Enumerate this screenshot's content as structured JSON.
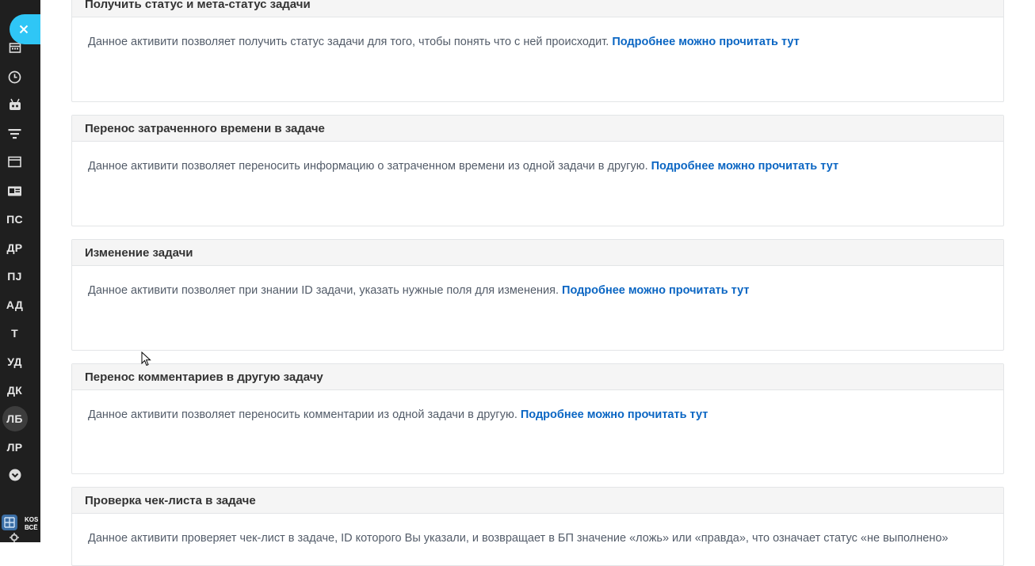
{
  "sidebar": {
    "close_icon": "close-icon",
    "icons": [
      "calendar-icon",
      "clock-icon",
      "robot-icon",
      "filter-icon",
      "window-icon",
      "contact-card-icon"
    ],
    "avatars": [
      {
        "label": "ПС"
      },
      {
        "label": "ДР"
      },
      {
        "label": "ПJ"
      },
      {
        "label": "АД"
      },
      {
        "label": "Т"
      },
      {
        "label": "УД"
      },
      {
        "label": "ДК"
      },
      {
        "label": "ЛБ",
        "active": true
      },
      {
        "label": "ЛР"
      }
    ],
    "more_icon": "chevron-down-circle-icon",
    "brand_text_line1": "KOS",
    "brand_text_line2": "ВСЁ"
  },
  "cards": [
    {
      "title": "Получить статус и мета-статус задачи",
      "description": "Данное активити позволяет получить статус задачи для того, чтобы понять что с ней происходит.",
      "link": "Подробнее можно прочитать тут"
    },
    {
      "title": "Перенос затраченного времени в задаче",
      "description": "Данное активити позволяет переносить информацию о затраченном времени из одной задачи в другую.",
      "link": "Подробнее можно прочитать тут"
    },
    {
      "title": "Изменение задачи",
      "description": "Данное активити позволяет при знании ID задачи, указать нужные поля для изменения.",
      "link": "Подробнее можно прочитать тут"
    },
    {
      "title": "Перенос комментариев в другую задачу",
      "description": "Данное активити позволяет переносить комментарии из одной задачи в другую.",
      "link": "Подробнее можно прочитать тут"
    },
    {
      "title": "Проверка чек-листа в задаче",
      "description": "Данное активити проверяет чек-лист в задаче, ID которого Вы указали, и возвращает в БП значение «ложь» или «правда», что означает статус «не выполнено»",
      "link": ""
    }
  ],
  "colors": {
    "sidebar_bg": "#1f1f1f",
    "accent": "#2fc6f6",
    "link": "#0b66c3"
  }
}
